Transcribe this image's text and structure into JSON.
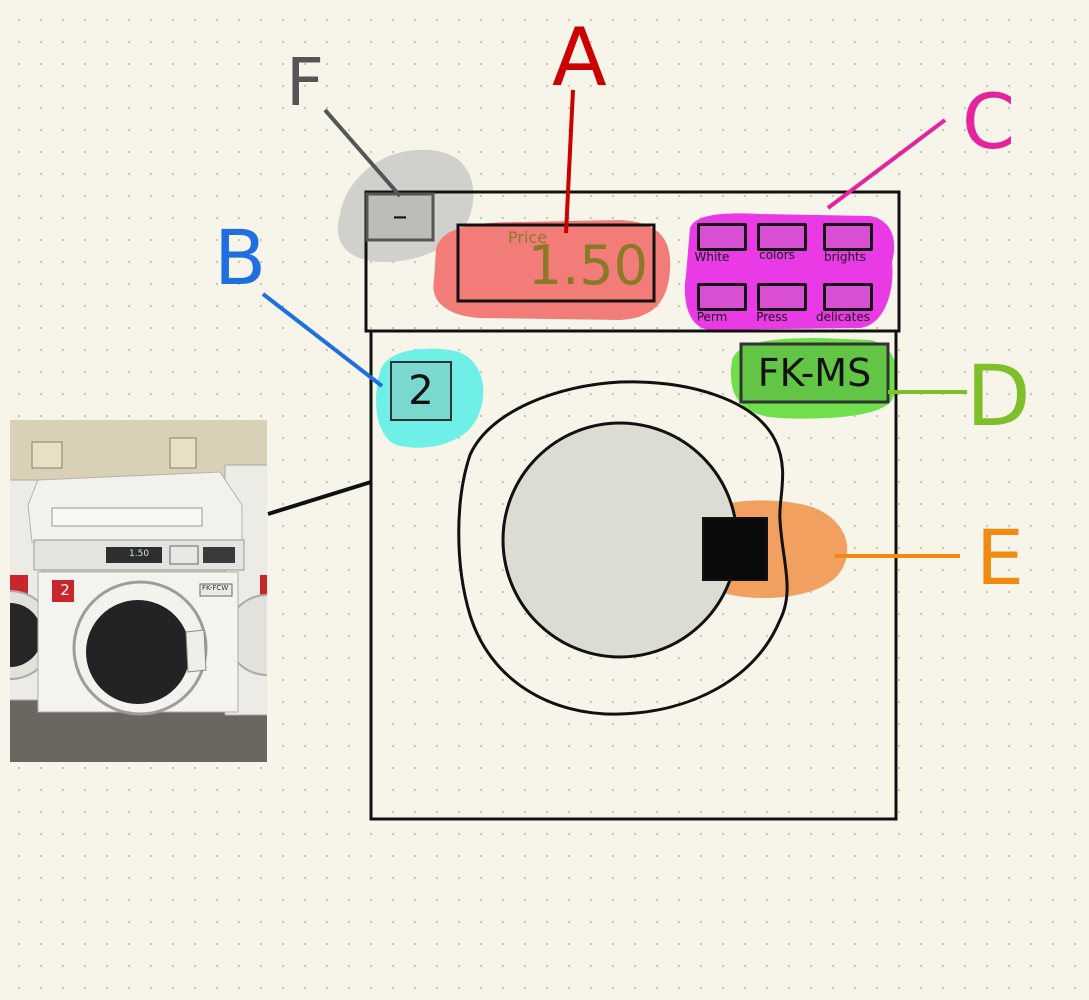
{
  "labels": {
    "a": "A",
    "b": "B",
    "c": "C",
    "d": "D",
    "e": "E",
    "f": "F"
  },
  "control_panel": {
    "minus_button": "–",
    "price_label": "Price",
    "price_value": "1.50",
    "cycle_buttons": [
      "White",
      "colors",
      "brights",
      "Perm",
      "Press",
      "delicates"
    ]
  },
  "machine": {
    "unit_number": "2",
    "model_label": "FK-MS"
  },
  "photo": {
    "display_value": "1.50",
    "unit_badge": "2",
    "side_label": "FK-FCW"
  },
  "colors": {
    "label_a": "#cc0000",
    "label_b": "#1f6fe0",
    "label_c": "#e5239c",
    "label_d": "#7fbf2a",
    "label_e": "#f08a10",
    "label_f": "#555555",
    "highlight_a": "#f27c78",
    "highlight_b": "#6ff0e6",
    "highlight_c": "#ea3ae6",
    "highlight_d": "#6fe04c",
    "highlight_e": "#f1a05f",
    "highlight_f": "#d0d0cc",
    "drum": "#dcdcd4"
  }
}
